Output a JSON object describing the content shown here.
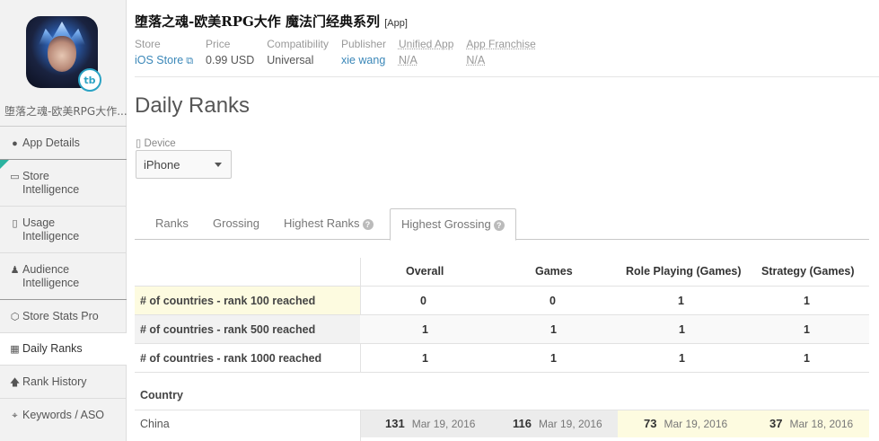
{
  "sidebar": {
    "app_name": "堕落之魂-欧美RPG大作...",
    "badge": "tb",
    "items": [
      {
        "label": "App Details",
        "icon": "info-icon",
        "glyph": "❶"
      },
      {
        "label": "Store\nIntelligence",
        "icon": "store-icon",
        "glyph": "▭"
      },
      {
        "label": "Usage\nIntelligence",
        "icon": "device-usage-icon",
        "glyph": "▯"
      },
      {
        "label": "Audience\nIntelligence",
        "icon": "person-icon",
        "glyph": "⚲"
      },
      {
        "label": "Store Stats Pro",
        "icon": "hexagon-icon",
        "glyph": "⬡"
      },
      {
        "label": "Daily Ranks",
        "icon": "calendar-icon",
        "glyph": "▦"
      },
      {
        "label": "Rank History",
        "icon": "arrow-up-icon",
        "glyph": "↑"
      },
      {
        "label": "Keywords / ASO",
        "icon": "keyword-icon",
        "glyph": "⌖"
      }
    ]
  },
  "header": {
    "title": "堕落之魂-欧美RPG大作 魔法门经典系列",
    "tag": "[App]",
    "meta": {
      "store_label": "Store",
      "store_value": "iOS Store",
      "price_label": "Price",
      "price_value": "0.99 USD",
      "compat_label": "Compatibility",
      "compat_value": "Universal",
      "publisher_label": "Publisher",
      "publisher_value": "xie wang",
      "unified_label": "Unified App",
      "unified_value": "N/A",
      "franchise_label": "App Franchise",
      "franchise_value": "N/A"
    }
  },
  "page": {
    "title": "Daily Ranks",
    "device_label": "Device",
    "device_value": "iPhone"
  },
  "tabs": [
    {
      "label": "Ranks"
    },
    {
      "label": "Grossing"
    },
    {
      "label": "Highest Ranks"
    },
    {
      "label": "Highest Grossing"
    }
  ],
  "table": {
    "columns": [
      "Overall",
      "Games",
      "Role Playing (Games)",
      "Strategy (Games)"
    ],
    "rows": [
      {
        "label": "# of countries - rank 100 reached",
        "values": [
          "0",
          "0",
          "1",
          "1"
        ]
      },
      {
        "label": "# of countries - rank 500 reached",
        "values": [
          "1",
          "1",
          "1",
          "1"
        ]
      },
      {
        "label": "# of countries - rank 1000 reached",
        "values": [
          "1",
          "1",
          "1",
          "1"
        ]
      }
    ],
    "country_header": "Country",
    "countries": [
      {
        "name": "China",
        "cells": [
          {
            "rank": "131",
            "date": "Mar 19, 2016"
          },
          {
            "rank": "116",
            "date": "Mar 19, 2016"
          },
          {
            "rank": "73",
            "date": "Mar 19, 2016"
          },
          {
            "rank": "37",
            "date": "Mar 18, 2016"
          }
        ]
      }
    ]
  },
  "colors": {
    "highlight_yellow": "#fdfbe0",
    "grey_cell": "#ececec",
    "link": "#3a87b8",
    "accent_teal": "#2bb3a0"
  }
}
